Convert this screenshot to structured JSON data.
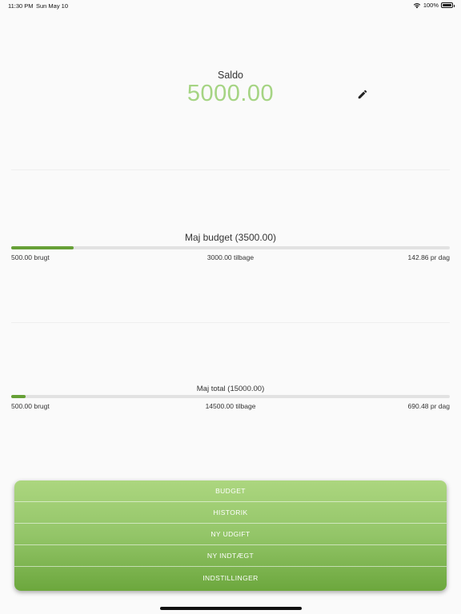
{
  "status_bar": {
    "time": "11:30 PM",
    "date": "Sun May 10",
    "battery": "100%"
  },
  "balance": {
    "label": "Saldo",
    "value": "5000.00",
    "accent_color": "#a5d483",
    "edit_icon": "pencil-icon"
  },
  "monthly_budget": {
    "title": "Maj budget (3500.00)",
    "spent": "500.00 brugt",
    "remaining": "3000.00 tilbage",
    "per_day": "142.86 pr dag",
    "progress_fraction": 0.143
  },
  "monthly_total": {
    "title": "Maj total (15000.00)",
    "spent": "500.00 brugt",
    "remaining": "14500.00 tilbage",
    "per_day": "690.48 pr dag",
    "progress_fraction": 0.033
  },
  "menu": {
    "items": [
      "BUDGET",
      "HISTORIK",
      "NY UDGIFT",
      "NY INDTÆGT",
      "INDSTILLINGER"
    ],
    "gradient_top": "#acd67f",
    "gradient_bottom": "#6ca73d"
  },
  "progress_color": "#66a036"
}
